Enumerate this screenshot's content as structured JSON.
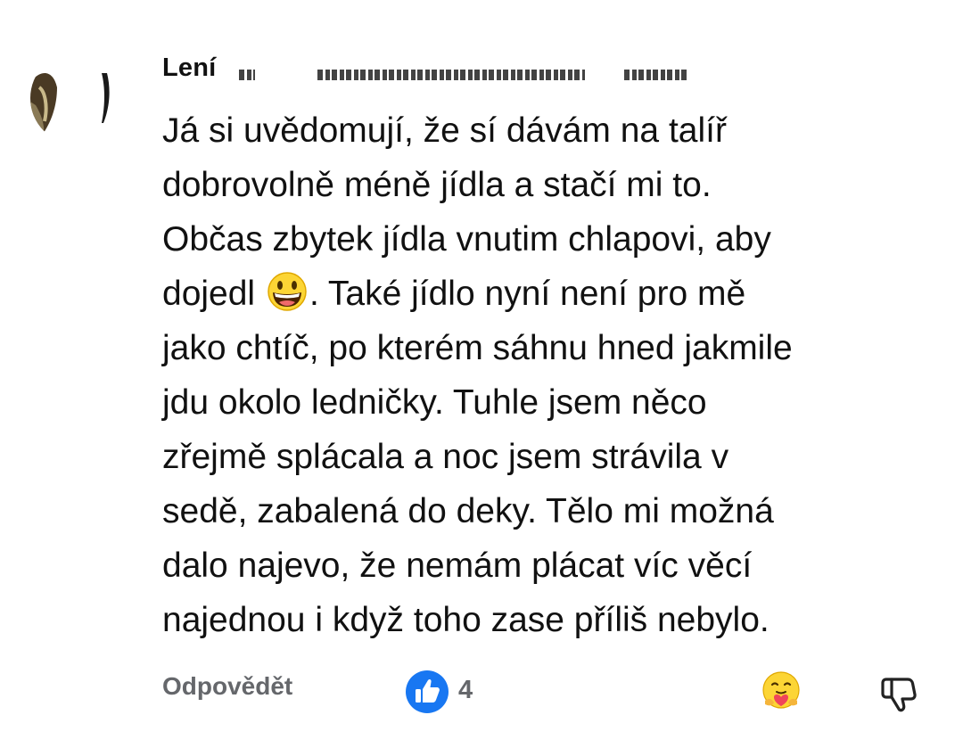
{
  "comment": {
    "author_visible": "Lení",
    "lines": [
      "Já si uvědomují, že sí dávám na talíř",
      "dobrovolně méně jídla a stačí mi to.",
      "Občas zbytek jídla vnutim chlapovi, aby",
      "dojedl ",
      ". Také jídlo nyní není pro mě",
      "jako chtíč, po kterém sáhnu hned jakmile",
      "jdu okolo ledničky. Tuhle jsem něco",
      "zřejmě splácala a noc jsem strávila v",
      "sedě, zabalená do deky. Tělo mi možná",
      "dalo najevo, že nemám plácat víc věcí",
      "najednou i když toho zase příliš nebylo."
    ]
  },
  "footer": {
    "reply_label": "Odpovědět",
    "like_count": "4"
  },
  "colors": {
    "like_blue": "#1877f2",
    "muted_text": "#65676b",
    "emoji_yellow": "#fcd535"
  },
  "icons": {
    "like": "thumbs-up-icon",
    "care": "care-reaction-icon",
    "dislike": "thumbs-down-icon",
    "emoji": "grinning-face-icon"
  }
}
